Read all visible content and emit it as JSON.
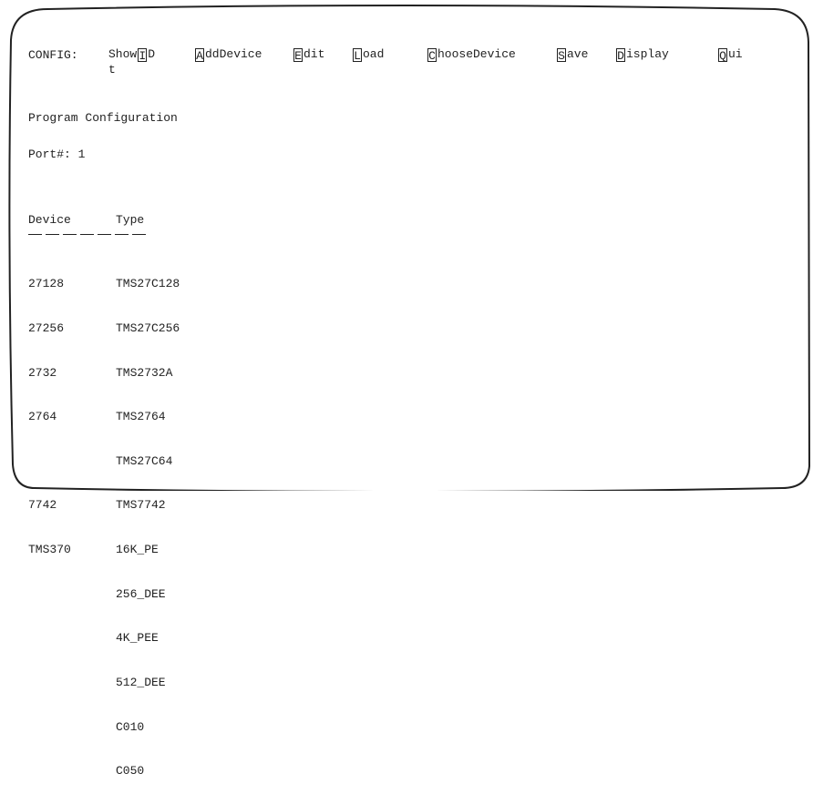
{
  "menu": {
    "prefix": "CONFIG:",
    "items": [
      {
        "before": "Show",
        "key": "I",
        "after": "D",
        "wrap": "t"
      },
      {
        "key": "A",
        "after": "ddDevice"
      },
      {
        "key": "E",
        "after": "dit"
      },
      {
        "key": "L",
        "after": "oad"
      },
      {
        "key": "C",
        "after": "hooseDevice"
      },
      {
        "key": "S",
        "after": "ave"
      },
      {
        "key": "D",
        "after": "isplay"
      },
      {
        "key": "Q",
        "after": "ui"
      }
    ]
  },
  "title": "Program Configuration",
  "port": "Port#: 1",
  "table": {
    "headers": {
      "device": "Device",
      "type": "Type"
    },
    "devices": [
      "27128",
      "27256",
      "2732",
      "2764",
      "",
      "7742",
      "TMS370",
      "",
      "",
      "",
      "",
      ""
    ],
    "types": [
      "TMS27C128",
      "TMS27C256",
      "TMS2732A",
      "TMS2764",
      "TMS27C64",
      "TMS7742",
      "16K_PE",
      "256_DEE",
      "4K_PEE",
      "512_DEE",
      "C010",
      "C050"
    ]
  }
}
